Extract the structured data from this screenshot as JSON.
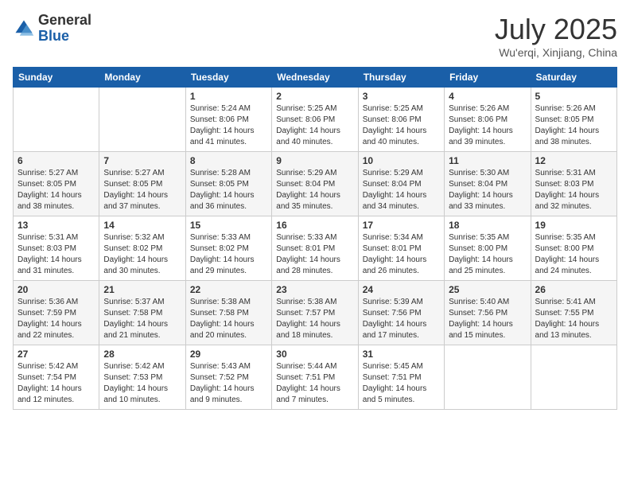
{
  "logo": {
    "general": "General",
    "blue": "Blue"
  },
  "header": {
    "month": "July 2025",
    "location": "Wu'erqi, Xinjiang, China"
  },
  "weekdays": [
    "Sunday",
    "Monday",
    "Tuesday",
    "Wednesday",
    "Thursday",
    "Friday",
    "Saturday"
  ],
  "weeks": [
    [
      {
        "day": "",
        "sunrise": "",
        "sunset": "",
        "daylight": ""
      },
      {
        "day": "",
        "sunrise": "",
        "sunset": "",
        "daylight": ""
      },
      {
        "day": "1",
        "sunrise": "Sunrise: 5:24 AM",
        "sunset": "Sunset: 8:06 PM",
        "daylight": "Daylight: 14 hours and 41 minutes."
      },
      {
        "day": "2",
        "sunrise": "Sunrise: 5:25 AM",
        "sunset": "Sunset: 8:06 PM",
        "daylight": "Daylight: 14 hours and 40 minutes."
      },
      {
        "day": "3",
        "sunrise": "Sunrise: 5:25 AM",
        "sunset": "Sunset: 8:06 PM",
        "daylight": "Daylight: 14 hours and 40 minutes."
      },
      {
        "day": "4",
        "sunrise": "Sunrise: 5:26 AM",
        "sunset": "Sunset: 8:06 PM",
        "daylight": "Daylight: 14 hours and 39 minutes."
      },
      {
        "day": "5",
        "sunrise": "Sunrise: 5:26 AM",
        "sunset": "Sunset: 8:05 PM",
        "daylight": "Daylight: 14 hours and 38 minutes."
      }
    ],
    [
      {
        "day": "6",
        "sunrise": "Sunrise: 5:27 AM",
        "sunset": "Sunset: 8:05 PM",
        "daylight": "Daylight: 14 hours and 38 minutes."
      },
      {
        "day": "7",
        "sunrise": "Sunrise: 5:27 AM",
        "sunset": "Sunset: 8:05 PM",
        "daylight": "Daylight: 14 hours and 37 minutes."
      },
      {
        "day": "8",
        "sunrise": "Sunrise: 5:28 AM",
        "sunset": "Sunset: 8:05 PM",
        "daylight": "Daylight: 14 hours and 36 minutes."
      },
      {
        "day": "9",
        "sunrise": "Sunrise: 5:29 AM",
        "sunset": "Sunset: 8:04 PM",
        "daylight": "Daylight: 14 hours and 35 minutes."
      },
      {
        "day": "10",
        "sunrise": "Sunrise: 5:29 AM",
        "sunset": "Sunset: 8:04 PM",
        "daylight": "Daylight: 14 hours and 34 minutes."
      },
      {
        "day": "11",
        "sunrise": "Sunrise: 5:30 AM",
        "sunset": "Sunset: 8:04 PM",
        "daylight": "Daylight: 14 hours and 33 minutes."
      },
      {
        "day": "12",
        "sunrise": "Sunrise: 5:31 AM",
        "sunset": "Sunset: 8:03 PM",
        "daylight": "Daylight: 14 hours and 32 minutes."
      }
    ],
    [
      {
        "day": "13",
        "sunrise": "Sunrise: 5:31 AM",
        "sunset": "Sunset: 8:03 PM",
        "daylight": "Daylight: 14 hours and 31 minutes."
      },
      {
        "day": "14",
        "sunrise": "Sunrise: 5:32 AM",
        "sunset": "Sunset: 8:02 PM",
        "daylight": "Daylight: 14 hours and 30 minutes."
      },
      {
        "day": "15",
        "sunrise": "Sunrise: 5:33 AM",
        "sunset": "Sunset: 8:02 PM",
        "daylight": "Daylight: 14 hours and 29 minutes."
      },
      {
        "day": "16",
        "sunrise": "Sunrise: 5:33 AM",
        "sunset": "Sunset: 8:01 PM",
        "daylight": "Daylight: 14 hours and 28 minutes."
      },
      {
        "day": "17",
        "sunrise": "Sunrise: 5:34 AM",
        "sunset": "Sunset: 8:01 PM",
        "daylight": "Daylight: 14 hours and 26 minutes."
      },
      {
        "day": "18",
        "sunrise": "Sunrise: 5:35 AM",
        "sunset": "Sunset: 8:00 PM",
        "daylight": "Daylight: 14 hours and 25 minutes."
      },
      {
        "day": "19",
        "sunrise": "Sunrise: 5:35 AM",
        "sunset": "Sunset: 8:00 PM",
        "daylight": "Daylight: 14 hours and 24 minutes."
      }
    ],
    [
      {
        "day": "20",
        "sunrise": "Sunrise: 5:36 AM",
        "sunset": "Sunset: 7:59 PM",
        "daylight": "Daylight: 14 hours and 22 minutes."
      },
      {
        "day": "21",
        "sunrise": "Sunrise: 5:37 AM",
        "sunset": "Sunset: 7:58 PM",
        "daylight": "Daylight: 14 hours and 21 minutes."
      },
      {
        "day": "22",
        "sunrise": "Sunrise: 5:38 AM",
        "sunset": "Sunset: 7:58 PM",
        "daylight": "Daylight: 14 hours and 20 minutes."
      },
      {
        "day": "23",
        "sunrise": "Sunrise: 5:38 AM",
        "sunset": "Sunset: 7:57 PM",
        "daylight": "Daylight: 14 hours and 18 minutes."
      },
      {
        "day": "24",
        "sunrise": "Sunrise: 5:39 AM",
        "sunset": "Sunset: 7:56 PM",
        "daylight": "Daylight: 14 hours and 17 minutes."
      },
      {
        "day": "25",
        "sunrise": "Sunrise: 5:40 AM",
        "sunset": "Sunset: 7:56 PM",
        "daylight": "Daylight: 14 hours and 15 minutes."
      },
      {
        "day": "26",
        "sunrise": "Sunrise: 5:41 AM",
        "sunset": "Sunset: 7:55 PM",
        "daylight": "Daylight: 14 hours and 13 minutes."
      }
    ],
    [
      {
        "day": "27",
        "sunrise": "Sunrise: 5:42 AM",
        "sunset": "Sunset: 7:54 PM",
        "daylight": "Daylight: 14 hours and 12 minutes."
      },
      {
        "day": "28",
        "sunrise": "Sunrise: 5:42 AM",
        "sunset": "Sunset: 7:53 PM",
        "daylight": "Daylight: 14 hours and 10 minutes."
      },
      {
        "day": "29",
        "sunrise": "Sunrise: 5:43 AM",
        "sunset": "Sunset: 7:52 PM",
        "daylight": "Daylight: 14 hours and 9 minutes."
      },
      {
        "day": "30",
        "sunrise": "Sunrise: 5:44 AM",
        "sunset": "Sunset: 7:51 PM",
        "daylight": "Daylight: 14 hours and 7 minutes."
      },
      {
        "day": "31",
        "sunrise": "Sunrise: 5:45 AM",
        "sunset": "Sunset: 7:51 PM",
        "daylight": "Daylight: 14 hours and 5 minutes."
      },
      {
        "day": "",
        "sunrise": "",
        "sunset": "",
        "daylight": ""
      },
      {
        "day": "",
        "sunrise": "",
        "sunset": "",
        "daylight": ""
      }
    ]
  ]
}
